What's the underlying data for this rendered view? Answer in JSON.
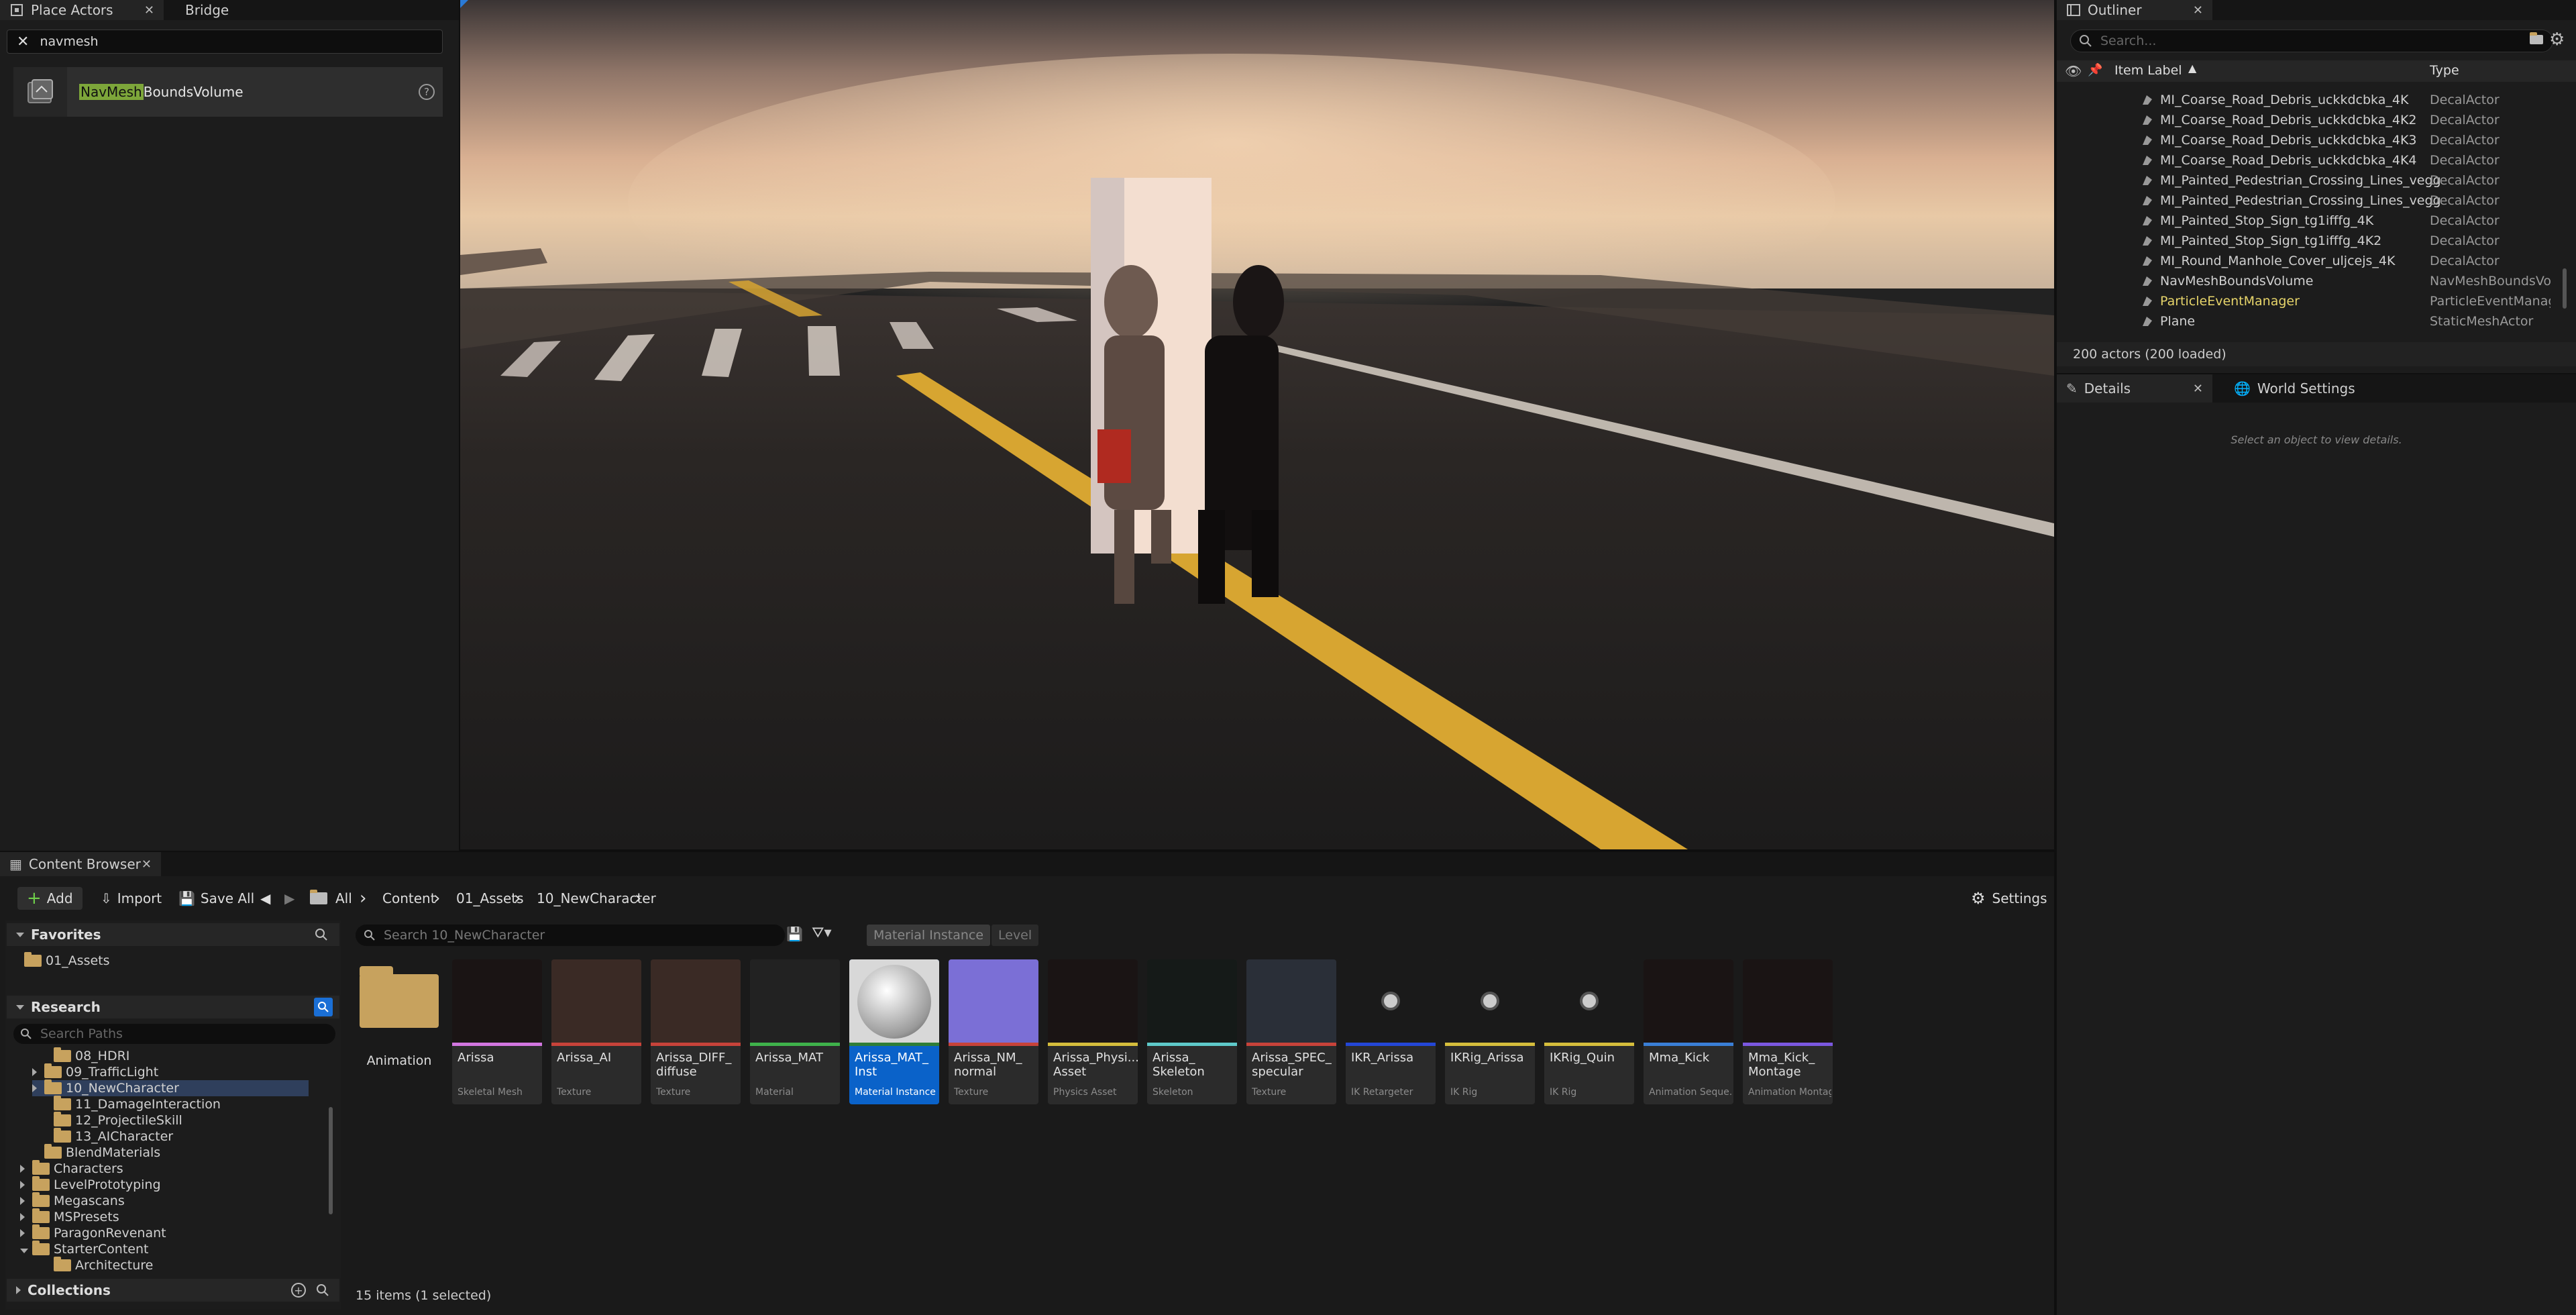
{
  "place_actors": {
    "tab_label": "Place Actors",
    "bridge_tab": "Bridge",
    "search_value": "navmesh",
    "result_highlight": "NavMesh",
    "result_rest": "BoundsVolume"
  },
  "outliner": {
    "tab_label": "Outliner",
    "search_placeholder": "Search...",
    "col_label": "Item Label",
    "col_type": "Type",
    "rows": [
      {
        "label": "MI_Coarse_Road_Debris_uckkdcbka_4K",
        "type": "DecalActor",
        "color": "#d0d0d0"
      },
      {
        "label": "MI_Coarse_Road_Debris_uckkdcbka_4K2",
        "type": "DecalActor",
        "color": "#d0d0d0"
      },
      {
        "label": "MI_Coarse_Road_Debris_uckkdcbka_4K3",
        "type": "DecalActor",
        "color": "#d0d0d0"
      },
      {
        "label": "MI_Coarse_Road_Debris_uckkdcbka_4K4",
        "type": "DecalActor",
        "color": "#d0d0d0"
      },
      {
        "label": "MI_Painted_Pedestrian_Crossing_Lines_vegg",
        "type": "DecalActor",
        "color": "#d0d0d0"
      },
      {
        "label": "MI_Painted_Pedestrian_Crossing_Lines_vegg",
        "type": "DecalActor",
        "color": "#d0d0d0"
      },
      {
        "label": "MI_Painted_Stop_Sign_tg1ifffg_4K",
        "type": "DecalActor",
        "color": "#d0d0d0"
      },
      {
        "label": "MI_Painted_Stop_Sign_tg1ifffg_4K2",
        "type": "DecalActor",
        "color": "#d0d0d0"
      },
      {
        "label": "MI_Round_Manhole_Cover_uljcejs_4K",
        "type": "DecalActor",
        "color": "#d0d0d0"
      },
      {
        "label": "NavMeshBoundsVolume",
        "type": "NavMeshBoundsVol",
        "color": "#d0d0d0"
      },
      {
        "label": "ParticleEventManager",
        "type": "ParticleEventManag",
        "color": "#e6d46a"
      },
      {
        "label": "Plane",
        "type": "StaticMeshActor",
        "color": "#d0d0d0"
      }
    ],
    "status": "200 actors (200 loaded)"
  },
  "details": {
    "tab_label": "Details",
    "world_settings_tab": "World Settings",
    "empty_text": "Select an object to view details."
  },
  "content_browser": {
    "tab_label": "Content Browser",
    "add_label": "Add",
    "import_label": "Import",
    "save_all_label": "Save All",
    "settings_label": "Settings",
    "breadcrumb": [
      "All",
      "Content",
      "01_Assets",
      "10_NewCharacter"
    ],
    "favorites_label": "Favorites",
    "favorites_items": [
      "01_Assets"
    ],
    "research_label": "Research",
    "search_paths_placeholder": "Search Paths",
    "tree": [
      {
        "label": "08_HDRI"
      },
      {
        "label": "09_TrafficLight"
      },
      {
        "label": "10_NewCharacter"
      },
      {
        "label": "11_DamageInteraction"
      },
      {
        "label": "12_ProjectileSkill"
      },
      {
        "label": "13_AICharacter"
      },
      {
        "label": "BlendMaterials"
      },
      {
        "label": "Characters"
      },
      {
        "label": "LevelPrototyping"
      },
      {
        "label": "Megascans"
      },
      {
        "label": "MSPresets"
      },
      {
        "label": "ParagonRevenant"
      },
      {
        "label": "StarterContent"
      },
      {
        "label": "Architecture"
      }
    ],
    "collections_label": "Collections",
    "asset_search_placeholder": "Search 10_NewCharacter",
    "filter_chips": [
      "Material Instance",
      "Level"
    ],
    "folder_label": "Animation",
    "assets": [
      {
        "name": "Arissa",
        "kind": "Skeletal Mesh",
        "bar": "#d276e0"
      },
      {
        "name": "Arissa_AI",
        "kind": "Texture",
        "bar": "#c7433a"
      },
      {
        "name": "Arissa_DIFF_ diffuse",
        "kind": "Texture",
        "bar": "#c7433a"
      },
      {
        "name": "Arissa_MAT",
        "kind": "Material",
        "bar": "#3fb24b"
      },
      {
        "name": "Arissa_MAT_ Inst",
        "kind": "Material Instance",
        "bar": "#2f7d37"
      },
      {
        "name": "Arissa_NM_ normal",
        "kind": "Texture",
        "bar": "#c7433a"
      },
      {
        "name": "Arissa_Physi... Asset",
        "kind": "Physics Asset",
        "bar": "#d5bd3c"
      },
      {
        "name": "Arissa_ Skeleton",
        "kind": "Skeleton",
        "bar": "#5ec9c9"
      },
      {
        "name": "Arissa_SPEC_ specular",
        "kind": "Texture",
        "bar": "#c7433a"
      },
      {
        "name": "IKR_Arissa",
        "kind": "IK Retargeter",
        "bar": "#2447d6"
      },
      {
        "name": "IKRig_Arissa",
        "kind": "IK Rig",
        "bar": "#d5bd3c"
      },
      {
        "name": "IKRig_Quin",
        "kind": "IK Rig",
        "bar": "#d5bd3c"
      },
      {
        "name": "Mma_Kick",
        "kind": "Animation Seque...",
        "bar": "#3a7fd6"
      },
      {
        "name": "Mma_Kick_ Montage",
        "kind": "Animation Montage",
        "bar": "#7b58e0"
      }
    ],
    "status": "15 items (1 selected)"
  }
}
